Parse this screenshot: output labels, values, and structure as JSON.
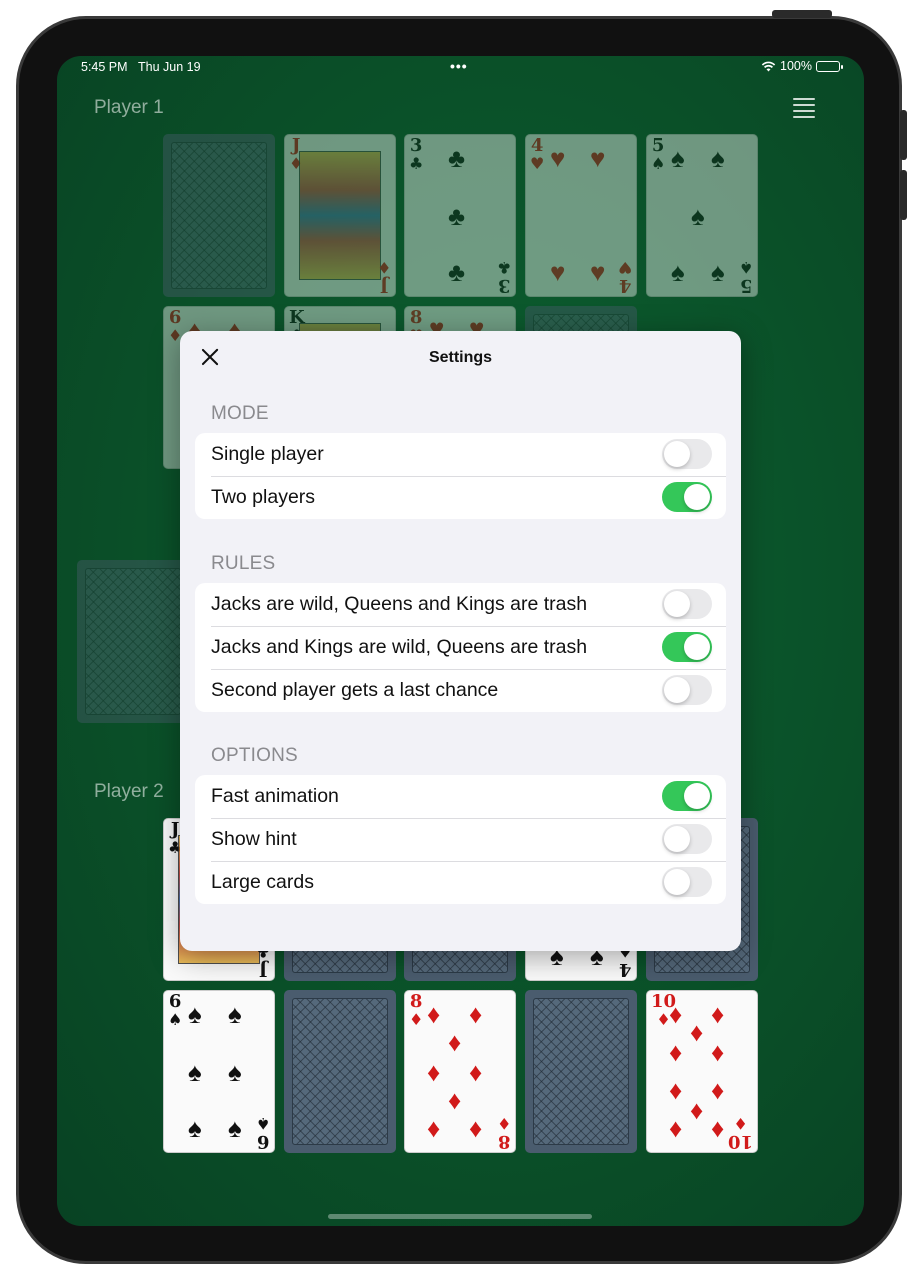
{
  "status_bar": {
    "time": "5:45 PM",
    "date": "Thu Jun 19",
    "battery_percent": "100%"
  },
  "game": {
    "player1_label": "Player 1",
    "player2_label": "Player 2",
    "player1_row1": [
      {
        "type": "back"
      },
      {
        "type": "face",
        "rank": "J",
        "suit": "♦",
        "color": "red"
      },
      {
        "type": "pip",
        "rank": "3",
        "suit": "♣",
        "color": "black"
      },
      {
        "type": "pip",
        "rank": "4",
        "suit": "♥",
        "color": "red"
      },
      {
        "type": "pip",
        "rank": "5",
        "suit": "♠",
        "color": "black"
      }
    ],
    "player1_row2": [
      {
        "rank": "6",
        "suit": "♦",
        "color": "red"
      },
      {
        "rank": "K",
        "suit": "♣",
        "color": "black"
      },
      {
        "rank": "8",
        "suit": "♥",
        "color": "red"
      },
      {
        "type": "back"
      }
    ],
    "player2_row1": [
      {
        "rank": "J",
        "suit": "♣",
        "color": "black"
      },
      {
        "type": "back"
      },
      {
        "type": "back"
      },
      {
        "rank": "4",
        "suit": "♠",
        "color": "black"
      },
      {
        "type": "back"
      }
    ],
    "player2_row2": [
      {
        "rank": "6",
        "suit": "♠",
        "color": "black"
      },
      {
        "type": "back"
      },
      {
        "rank": "8",
        "suit": "♦",
        "color": "red"
      },
      {
        "type": "back"
      },
      {
        "rank": "10",
        "suit": "♦",
        "color": "red"
      }
    ]
  },
  "settings": {
    "title": "Settings",
    "sections": {
      "mode": {
        "header": "MODE",
        "rows": [
          {
            "label": "Single player",
            "on": false
          },
          {
            "label": "Two players",
            "on": true
          }
        ]
      },
      "rules": {
        "header": "RULES",
        "rows": [
          {
            "label": "Jacks are wild, Queens and Kings are trash",
            "on": false
          },
          {
            "label": "Jacks and Kings are wild, Queens are trash",
            "on": true
          },
          {
            "label": "Second player gets a last chance",
            "on": false
          }
        ]
      },
      "options": {
        "header": "OPTIONS",
        "rows": [
          {
            "label": "Fast animation",
            "on": true
          },
          {
            "label": "Show hint",
            "on": false
          },
          {
            "label": "Large cards",
            "on": false
          }
        ]
      }
    }
  },
  "colors": {
    "felt": "#0a4f28",
    "toggle_on": "#34c759",
    "toggle_off": "#e9e9eb",
    "card_red": "#d11a1a"
  }
}
